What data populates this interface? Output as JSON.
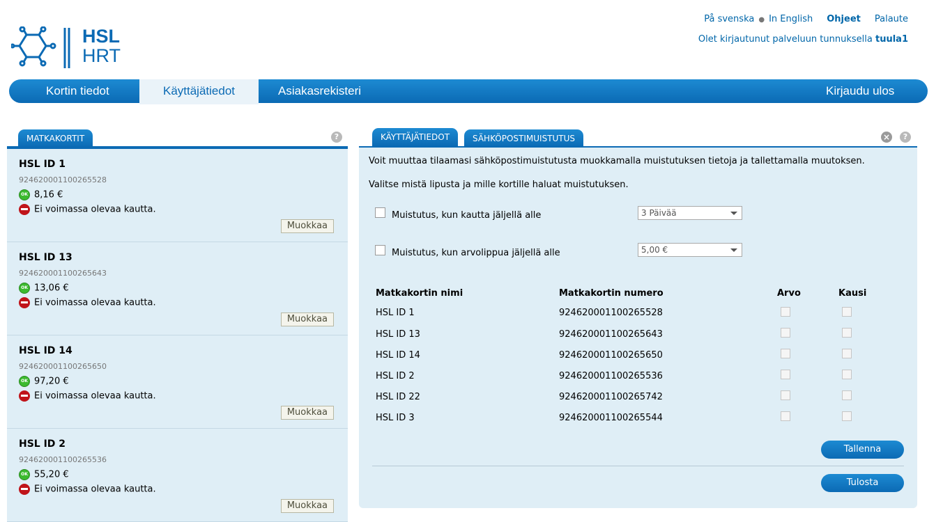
{
  "header": {
    "lang_swedish": "På svenska",
    "lang_english": "In English",
    "help": "Ohjeet",
    "feedback": "Palaute",
    "login_prefix": "Olet kirjautunut palveluun tunnuksella",
    "username": "tuula1",
    "logo_line1": "HSL",
    "logo_line2": "HRT"
  },
  "nav": {
    "card_info": "Kortin tiedot",
    "user_info": "Käyttäjätiedot",
    "customer_register": "Asiakasrekisteri",
    "logout": "Kirjaudu ulos"
  },
  "left": {
    "tab": "MATKAKORTIT",
    "help_icon": "?",
    "cards": [
      {
        "name": "HSL ID 1",
        "number": "924620001100265528",
        "value": "8,16 €",
        "status": "Ei voimassa olevaa kautta.",
        "edit": "Muokkaa"
      },
      {
        "name": "HSL ID 13",
        "number": "924620001100265643",
        "value": "13,06 €",
        "status": "Ei voimassa olevaa kautta.",
        "edit": "Muokkaa"
      },
      {
        "name": "HSL ID 14",
        "number": "924620001100265650",
        "value": "97,20 €",
        "status": "Ei voimassa olevaa kautta.",
        "edit": "Muokkaa"
      },
      {
        "name": "HSL ID 2",
        "number": "924620001100265536",
        "value": "55,20 €",
        "status": "Ei voimassa olevaa kautta.",
        "edit": "Muokkaa"
      }
    ],
    "ok_badge": "OK"
  },
  "right": {
    "tab_user": "KÄYTTÄJÄTIEDOT",
    "tab_email": "SÄHKÖPOSTIMUISTUTUS",
    "close_icon": "×",
    "help_icon": "?",
    "intro1": "Voit muuttaa tilaamasi sähköpostimuistutusta muokkamalla muistutuksen tietoja ja tallettamalla muutoksen.",
    "intro2": "Valitse mistä lipusta ja mille kortille haluat muistutuksen.",
    "option_period_label": "Muistutus, kun kautta jäljellä alle",
    "option_period_value": "3 Päivää",
    "option_value_label": "Muistutus, kun arvolippua jäljellä alle",
    "option_value_value": "5,00 €",
    "columns": {
      "name": "Matkakortin nimi",
      "number": "Matkakortin numero",
      "value": "Arvo",
      "period": "Kausi"
    },
    "rows": [
      {
        "name": "HSL ID 1",
        "number": "924620001100265528"
      },
      {
        "name": "HSL ID 13",
        "number": "924620001100265643"
      },
      {
        "name": "HSL ID 14",
        "number": "924620001100265650"
      },
      {
        "name": "HSL ID 2",
        "number": "924620001100265536"
      },
      {
        "name": "HSL ID 22",
        "number": "924620001100265742"
      },
      {
        "name": "HSL ID 3",
        "number": "924620001100265544"
      }
    ],
    "save": "Tallenna",
    "print": "Tulosta"
  },
  "colors": {
    "brand_blue": "#0b6ab4",
    "panel_bg": "#dfeef6",
    "link": "#0066a9"
  }
}
